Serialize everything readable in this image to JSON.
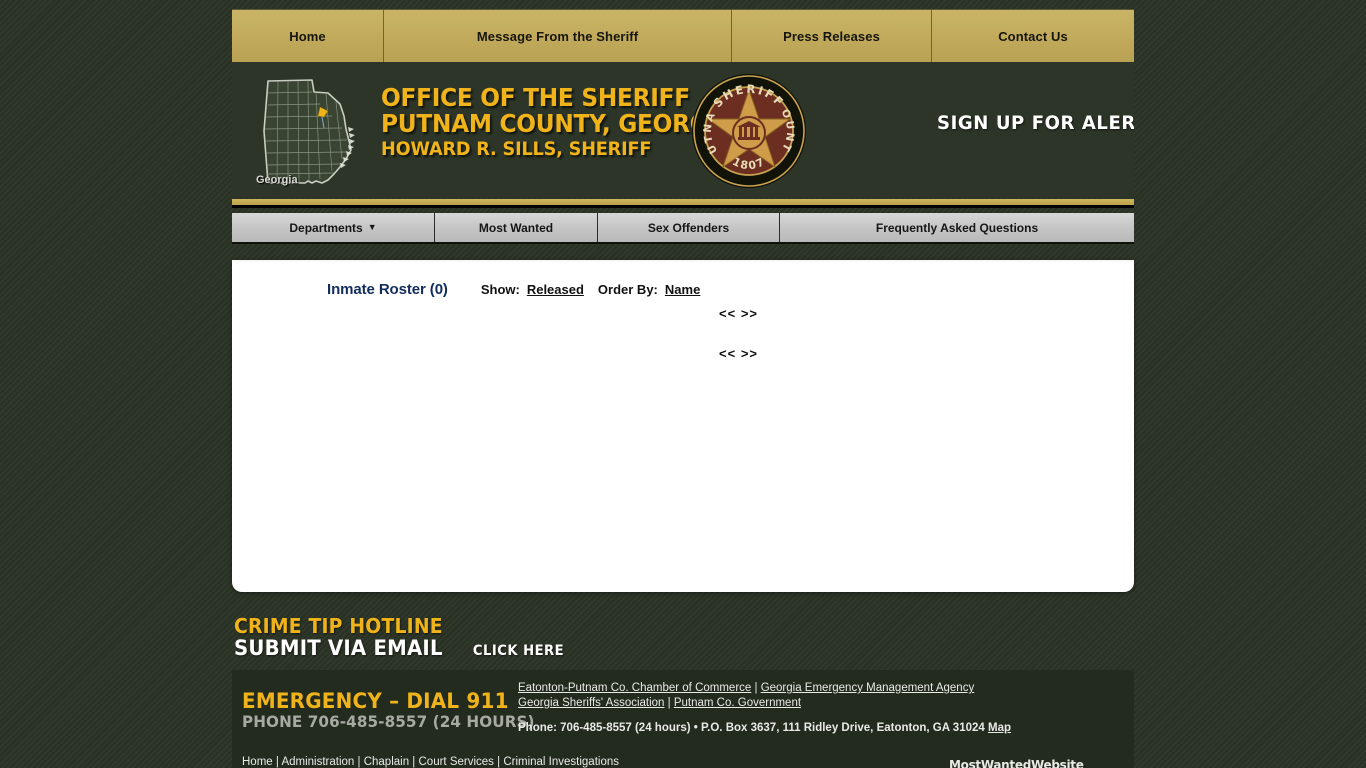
{
  "top_nav": {
    "items": [
      {
        "label": "Home"
      },
      {
        "label": "Message From the Sheriff"
      },
      {
        "label": "Press Releases"
      },
      {
        "label": "Contact Us"
      }
    ]
  },
  "header": {
    "map_label": "Georgia",
    "title_line1": "OFFICE OF THE SHERIFF",
    "title_line2": "PUTNAM COUNTY, GEORGIA",
    "title_line3": "HOWARD R. SILLS, SHERIFF",
    "alerts_label": "SIGN UP FOR ALERTS",
    "badge": {
      "top_text": "SHERIFF",
      "left_text": "PUTNAM",
      "right_text": "COUNTY",
      "year": "1807"
    },
    "colors": {
      "gold": "#f0b41a",
      "dark_green": "#2c3527",
      "nav_gold": "#c2ab5c"
    }
  },
  "sub_nav": {
    "items": [
      {
        "label": "Departments",
        "caret": "▼"
      },
      {
        "label": "Most Wanted",
        "caret": ""
      },
      {
        "label": "Sex Offenders",
        "caret": ""
      },
      {
        "label": "Frequently Asked Questions",
        "caret": ""
      }
    ]
  },
  "main": {
    "roster_title": "Inmate Roster (0)",
    "show_label": "Show:",
    "show_value": "Released",
    "order_label": "Order By:",
    "order_value": "Name",
    "pager_prev": "<<",
    "pager_next": ">>",
    "rows": []
  },
  "crime_tip": {
    "line1": "CRIME TIP HOTLINE",
    "line2": "SUBMIT VIA EMAIL",
    "click_here": "CLICK HERE"
  },
  "footer": {
    "emergency_line1": "EMERGENCY – DIAL 911",
    "emergency_line2": "PHONE 706-485-8557 (24 HOURS)",
    "links_row1": [
      {
        "label": "Eatonton-Putnam Co. Chamber of Commerce"
      },
      {
        "label": "Georgia Emergency Management Agency"
      }
    ],
    "links_row2": [
      {
        "label": "Georgia Sheriffs' Association"
      },
      {
        "label": "Putnam Co. Government"
      }
    ],
    "separator": " | ",
    "phone_line": "Phone: 706-485-8557 (24 hours) • P.O. Box 3637, 111 Ridley Drive, Eatonton, GA 31024 ",
    "map_link": "Map",
    "bottom_nav": [
      {
        "label": "Home"
      },
      {
        "label": "Administration"
      },
      {
        "label": "Chaplain"
      },
      {
        "label": "Court Services"
      },
      {
        "label": "Criminal Investigations"
      }
    ],
    "credit": "MostWantedWebsite"
  }
}
